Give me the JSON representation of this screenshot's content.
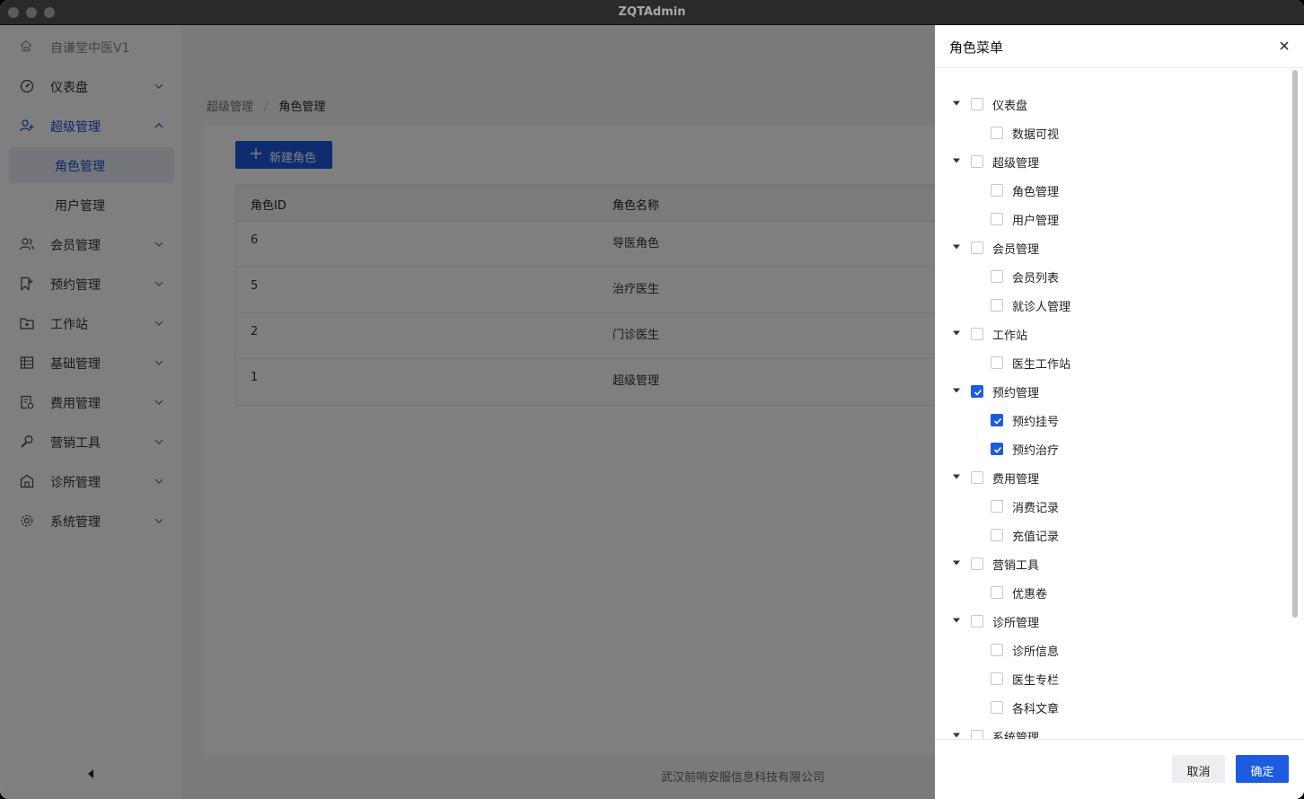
{
  "window": {
    "title": "ZQTAdmin"
  },
  "sidebar": {
    "brand": "自谦堂中医V1",
    "items": [
      {
        "label": "仪表盘",
        "icon": "dashboard-icon"
      },
      {
        "label": "超级管理",
        "icon": "user-add-icon"
      },
      {
        "label": "角色管理"
      },
      {
        "label": "用户管理"
      },
      {
        "label": "会员管理",
        "icon": "users-icon"
      },
      {
        "label": "预约管理",
        "icon": "bookmark-icon"
      },
      {
        "label": "工作站",
        "icon": "folder-plus-icon"
      },
      {
        "label": "基础管理",
        "icon": "table-icon"
      },
      {
        "label": "费用管理",
        "icon": "receipt-icon"
      },
      {
        "label": "营销工具",
        "icon": "wrench-icon"
      },
      {
        "label": "诊所管理",
        "icon": "building-icon"
      },
      {
        "label": "系统管理",
        "icon": "gear-icon"
      }
    ]
  },
  "breadcrumb": {
    "parent": "超级管理",
    "separator": "/",
    "current": "角色管理"
  },
  "toolbar": {
    "new_role_label": "新建角色"
  },
  "table": {
    "columns": [
      "角色ID",
      "角色名称"
    ],
    "rows": [
      {
        "id": "6",
        "name": "导医角色"
      },
      {
        "id": "5",
        "name": "治疗医生"
      },
      {
        "id": "2",
        "name": "门诊医生"
      },
      {
        "id": "1",
        "name": "超级管理"
      }
    ]
  },
  "footer": {
    "company": "武汉前哨安服信息科技有限公司"
  },
  "drawer": {
    "title": "角色菜单",
    "cancel_label": "取消",
    "ok_label": "确定",
    "tree": [
      {
        "label": "仪表盘",
        "level": 0,
        "checked": false
      },
      {
        "label": "数据可视",
        "level": 1,
        "checked": false
      },
      {
        "label": "超级管理",
        "level": 0,
        "checked": false
      },
      {
        "label": "角色管理",
        "level": 1,
        "checked": false
      },
      {
        "label": "用户管理",
        "level": 1,
        "checked": false
      },
      {
        "label": "会员管理",
        "level": 0,
        "checked": false
      },
      {
        "label": "会员列表",
        "level": 1,
        "checked": false
      },
      {
        "label": "就诊人管理",
        "level": 1,
        "checked": false
      },
      {
        "label": "工作站",
        "level": 0,
        "checked": false
      },
      {
        "label": "医生工作站",
        "level": 1,
        "checked": false
      },
      {
        "label": "预约管理",
        "level": 0,
        "checked": true
      },
      {
        "label": "预约挂号",
        "level": 1,
        "checked": true
      },
      {
        "label": "预约治疗",
        "level": 1,
        "checked": true
      },
      {
        "label": "费用管理",
        "level": 0,
        "checked": false
      },
      {
        "label": "消费记录",
        "level": 1,
        "checked": false
      },
      {
        "label": "充值记录",
        "level": 1,
        "checked": false
      },
      {
        "label": "营销工具",
        "level": 0,
        "checked": false
      },
      {
        "label": "优惠卷",
        "level": 1,
        "checked": false
      },
      {
        "label": "诊所管理",
        "level": 0,
        "checked": false
      },
      {
        "label": "诊所信息",
        "level": 1,
        "checked": false
      },
      {
        "label": "医生专栏",
        "level": 1,
        "checked": false
      },
      {
        "label": "各科文章",
        "level": 1,
        "checked": false
      },
      {
        "label": "系统管理",
        "level": 0,
        "checked": false
      }
    ]
  },
  "colors": {
    "accent": "#1d5be0",
    "overlay": "rgba(0,0,0,0.5)"
  }
}
